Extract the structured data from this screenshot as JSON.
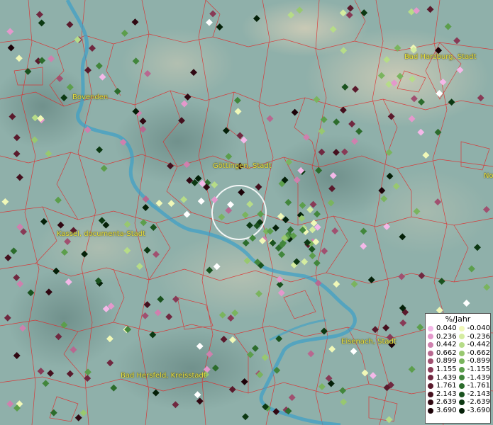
{
  "map": {
    "cities": [
      {
        "name": "Bad Harzburg, Stadt"
      },
      {
        "name": "Bovenden"
      },
      {
        "name": "Göttingen, Stadt"
      },
      {
        "name": "Kassel, documenta-Stadt"
      },
      {
        "name": "Eisenach, Stadt"
      },
      {
        "name": "Bad Hersfeld, Kreisstadt"
      },
      {
        "name": "No"
      }
    ],
    "colors": {
      "river": "#3aa0c8",
      "borders": "#e02828",
      "terrain": "#8fb0aa",
      "label": "#e8e040"
    }
  },
  "legend": {
    "title": "%/Jahr",
    "positive": [
      {
        "value": "0.040",
        "color": "#f4b8e8"
      },
      {
        "value": "0.236",
        "color": "#e498cc"
      },
      {
        "value": "0.442",
        "color": "#cf80ae"
      },
      {
        "value": "0.662",
        "color": "#b86890"
      },
      {
        "value": "0.899",
        "color": "#a05070"
      },
      {
        "value": "1.155",
        "color": "#883a56"
      },
      {
        "value": "1.439",
        "color": "#702840"
      },
      {
        "value": "1.761",
        "color": "#5a1a2c"
      },
      {
        "value": "2.143",
        "color": "#44101e"
      },
      {
        "value": "2.639",
        "color": "#300812"
      },
      {
        "value": "3.690",
        "color": "#1c0208"
      }
    ],
    "negative": [
      {
        "value": "-0.040",
        "color": "#f0f8b8"
      },
      {
        "value": "-0.236",
        "color": "#d4eca0"
      },
      {
        "value": "-0.442",
        "color": "#b6dc88"
      },
      {
        "value": "-0.662",
        "color": "#98c870"
      },
      {
        "value": "-0.899",
        "color": "#7ab45e"
      },
      {
        "value": "-1.155",
        "color": "#5c9e4c"
      },
      {
        "value": "-1.439",
        "color": "#42863c"
      },
      {
        "value": "-1.761",
        "color": "#2c6c2c"
      },
      {
        "value": "-2.143",
        "color": "#1a521e"
      },
      {
        "value": "-2.639",
        "color": "#0c3812"
      },
      {
        "value": "-3.690",
        "color": "#042008"
      }
    ]
  }
}
